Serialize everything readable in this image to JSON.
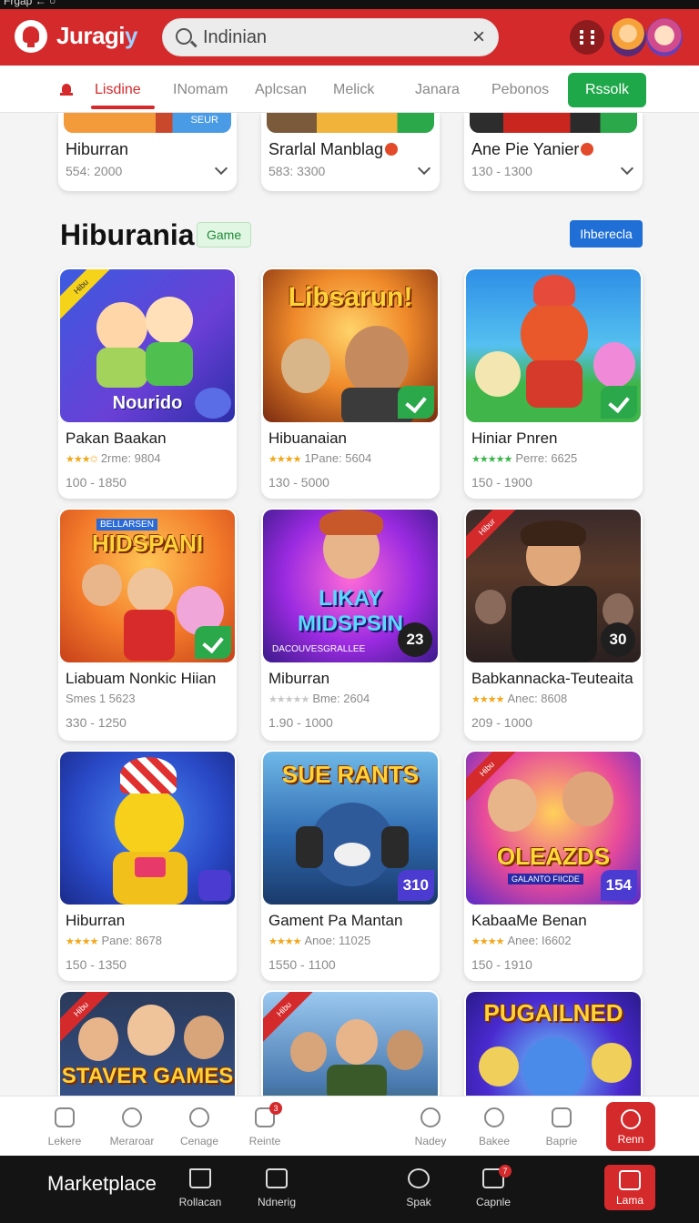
{
  "status": {
    "text": "Frgap ← ○"
  },
  "header": {
    "brand_main": "Juragi",
    "brand_tail": "y",
    "search_value": "Indinian",
    "clear_glyph": "×"
  },
  "tabs": {
    "items": [
      "Lisdine",
      "INomam",
      "Aplcsan",
      "Melick",
      "Janara",
      "Pebonos"
    ],
    "cta": "Rssolk"
  },
  "top_row": [
    {
      "title": "Hiburran",
      "meta": "554: 2000",
      "badge": false,
      "strip_label": "SEUR"
    },
    {
      "title": "Srarlal Manblag",
      "meta": "583: 3300",
      "badge": true
    },
    {
      "title": "Ane Pie Yanier",
      "meta": "130 - 1300",
      "badge": true
    }
  ],
  "section": {
    "title": "Hiburania",
    "tag": "Game",
    "see_all": "Ihberecla"
  },
  "cards": [
    {
      "title": "Pakan Baakan",
      "stars": "★★★✩",
      "rating": "2rme: 9804",
      "range": "100 - 1850",
      "art_text": "Nourido",
      "ribbon": "Hibu"
    },
    {
      "title": "Hibuanaian",
      "stars": "★★★★",
      "rating": "1Pane: 5604",
      "range": "130 - 5000",
      "art_text": "Libsarun!"
    },
    {
      "title": "Hiniar Pnren",
      "stars": "★★★★★",
      "rating": "Perre: 6625",
      "range": "150 - 1900"
    },
    {
      "title": "Liabuam Nonkic Hiian",
      "stars": "",
      "rating": "Smes 1 5623",
      "range": "330 - 1250",
      "art_text": "HIDSPANI",
      "art_sub": "BELLARSEN"
    },
    {
      "title": "Miburran",
      "stars": "★★★★★",
      "rating": "Bme: 2604",
      "range": "1.90 - 1000",
      "art_text": "LIKAY MIDSPSIN",
      "art_sub": "DACOUVESGRALLEE",
      "badge": "23"
    },
    {
      "title": "Babkannacka-Teuteaita",
      "stars": "★★★★",
      "rating": "Anec: 8608",
      "range": "209 - 1000",
      "badge": "30",
      "ribbon": "Hibur"
    },
    {
      "title": "Hiburran",
      "stars": "★★★★",
      "rating": "Pane: 8678",
      "range": "150 - 1350"
    },
    {
      "title": "Gament Pa Mantan",
      "stars": "★★★★",
      "rating": "Anoe: 11025",
      "range": "1550 - 1100",
      "art_text": "SUE RANTS",
      "badge": "310"
    },
    {
      "title": "KabaaMe Benan",
      "stars": "★★★★",
      "rating": "Anee: I6602",
      "range": "150 - 1910",
      "art_text": "OLEAZDS",
      "art_sub": "GALANTO FIICDE",
      "badge": "154",
      "ribbon": "Hibu"
    },
    {
      "art_text": "STAVER GAMES",
      "ribbon": "Hibu"
    },
    {
      "ribbon": "Hibu"
    },
    {
      "art_text": "PUGAILNED"
    }
  ],
  "nav": {
    "items": [
      "Lekere",
      "Meraroar",
      "Cenage",
      "Reinte",
      "Nadey",
      "Bakee",
      "Baprie",
      "Renn"
    ],
    "badge": "3"
  },
  "bottom": {
    "title": "Marketplace",
    "items": [
      "Rollacan",
      "Ndnerig",
      "Spak",
      "Capnle",
      "Lama"
    ],
    "badge": "7"
  },
  "colors": {
    "brand_red": "#d52a2c",
    "cta_green": "#1fa84a",
    "link_blue": "#1f6fd6"
  }
}
